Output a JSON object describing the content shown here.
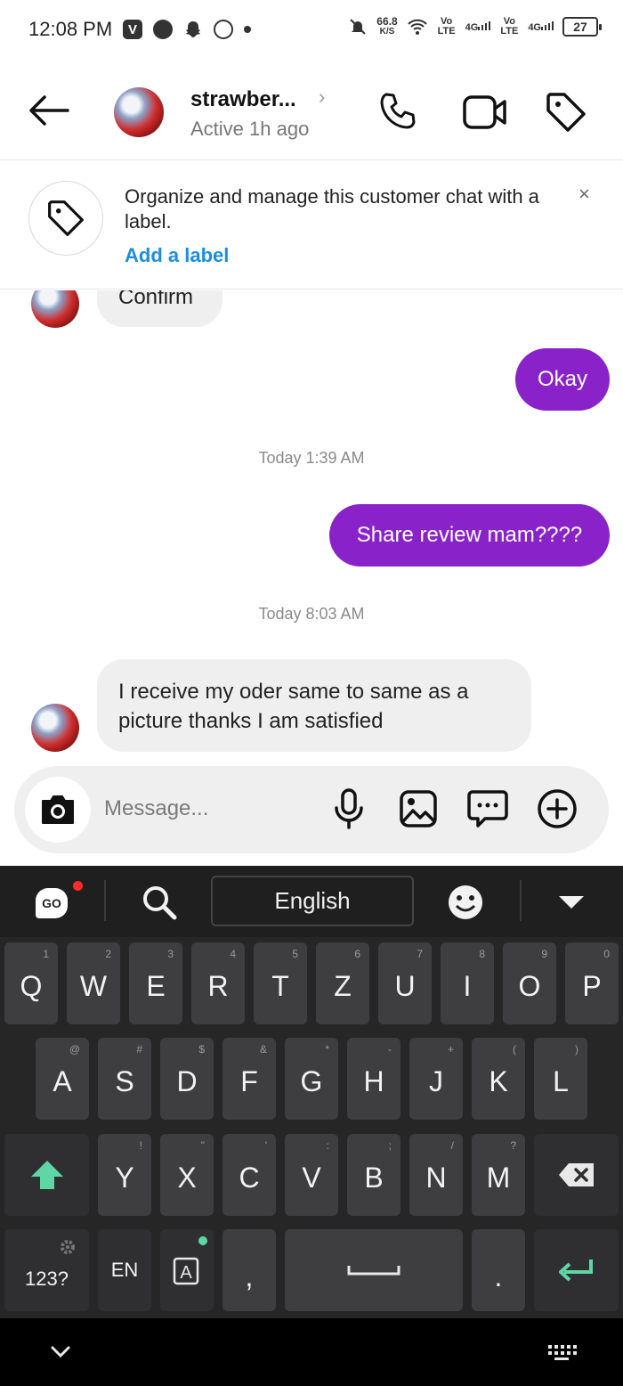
{
  "status_bar": {
    "time": "12:08 PM",
    "app_icon_label": "V",
    "net_speed_value": "66.8",
    "net_speed_unit": "K/S",
    "sim1_label": "Vo LTE",
    "sim1_gen": "4G",
    "sim2_label": "Vo LTE",
    "sim2_gen": "4G",
    "battery": "27"
  },
  "header": {
    "contact_name": "strawber...",
    "status": "Active 1h ago"
  },
  "label_banner": {
    "text": "Organize and manage this customer chat with a label.",
    "link": "Add a label",
    "close": "×"
  },
  "messages": [
    {
      "side": "in",
      "text": "Confirm"
    },
    {
      "side": "out",
      "text": "Okay"
    },
    {
      "side": "stamp",
      "text": "Today 1:39 AM"
    },
    {
      "side": "out",
      "text": "Share review mam????"
    },
    {
      "side": "stamp",
      "text": "Today 8:03 AM"
    },
    {
      "side": "in",
      "text": "I receive my  oder same to same as a picture thanks  I am satisfied"
    }
  ],
  "composer": {
    "placeholder": "Message..."
  },
  "keyboard": {
    "logo": "GO",
    "language": "English",
    "row1": [
      {
        "k": "Q",
        "h": "1"
      },
      {
        "k": "W",
        "h": "2"
      },
      {
        "k": "E",
        "h": "3"
      },
      {
        "k": "R",
        "h": "4"
      },
      {
        "k": "T",
        "h": "5"
      },
      {
        "k": "Z",
        "h": "6"
      },
      {
        "k": "U",
        "h": "7"
      },
      {
        "k": "I",
        "h": "8"
      },
      {
        "k": "O",
        "h": "9"
      },
      {
        "k": "P",
        "h": "0"
      }
    ],
    "row2": [
      {
        "k": "A",
        "h": "@"
      },
      {
        "k": "S",
        "h": "#"
      },
      {
        "k": "D",
        "h": "$"
      },
      {
        "k": "F",
        "h": "&"
      },
      {
        "k": "G",
        "h": "*"
      },
      {
        "k": "H",
        "h": "-"
      },
      {
        "k": "J",
        "h": "+"
      },
      {
        "k": "K",
        "h": "("
      },
      {
        "k": "L",
        "h": ")"
      }
    ],
    "row3": [
      {
        "k": "Y",
        "h": "!"
      },
      {
        "k": "X",
        "h": "\""
      },
      {
        "k": "C",
        "h": "'"
      },
      {
        "k": "V",
        "h": ":"
      },
      {
        "k": "B",
        "h": ";"
      },
      {
        "k": "N",
        "h": "/"
      },
      {
        "k": "M",
        "h": "?"
      }
    ],
    "numbers_key": "123?",
    "lang_key": "EN",
    "comma_key": ",",
    "period_key": ".",
    "accent_color": "#5fd6a5"
  },
  "icons": [
    "back-arrow-icon",
    "phone-icon",
    "video-icon",
    "tag-icon",
    "camera-icon",
    "mic-icon",
    "gallery-icon",
    "sticker-icon",
    "plus-icon",
    "search-icon",
    "emoji-icon",
    "dropdown-icon",
    "shift-icon",
    "backspace-icon",
    "enter-icon",
    "settings-icon",
    "keyboard-icon",
    "nav-down-icon"
  ]
}
